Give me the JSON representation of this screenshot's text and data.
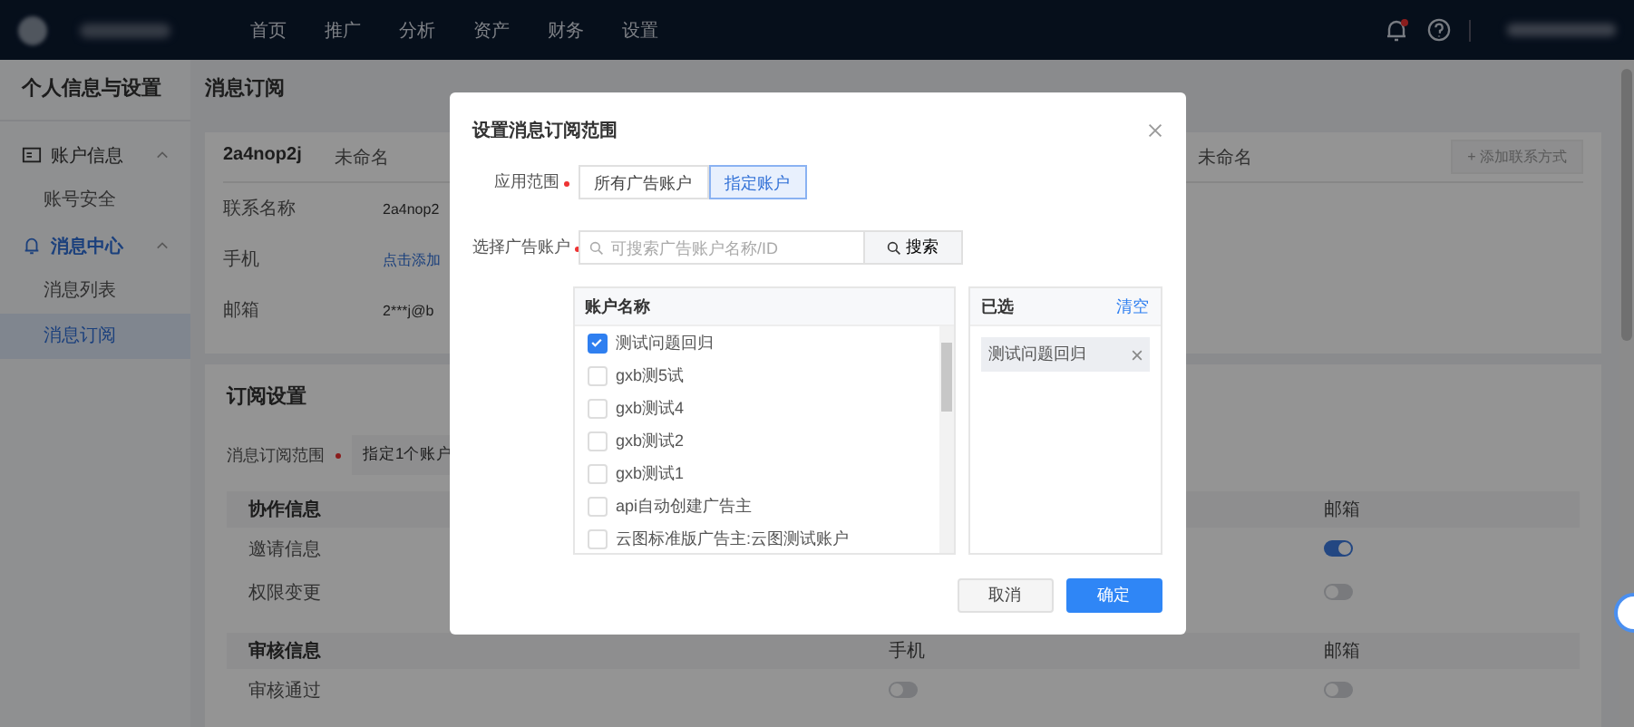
{
  "nav": {
    "items": [
      {
        "label": "首页",
        "selected": false
      },
      {
        "label": "推广",
        "selected": false
      },
      {
        "label": "分析",
        "selected": false
      },
      {
        "label": "资产",
        "selected": false
      },
      {
        "label": "财务",
        "selected": false
      },
      {
        "label": "设置",
        "selected": false
      }
    ],
    "notification_dot": true
  },
  "sidebar": {
    "title": "个人信息与设置",
    "groups": [
      {
        "label": "账户信息",
        "expanded": true,
        "active": false,
        "children": [
          {
            "label": "账号安全",
            "selected": false
          }
        ]
      },
      {
        "label": "消息中心",
        "expanded": true,
        "active": true,
        "children": [
          {
            "label": "消息列表",
            "selected": false
          },
          {
            "label": "消息订阅",
            "selected": true
          }
        ]
      }
    ]
  },
  "page_title": "消息订阅",
  "contact_card": {
    "accounts": [
      {
        "id": "2a4nop2j",
        "name": "未命名"
      },
      {
        "name": "未命名"
      }
    ],
    "add_button": "+ 添加联系方式",
    "fields": [
      {
        "label": "联系名称",
        "value": "2a4nop2",
        "kind": "text"
      },
      {
        "label": "手机",
        "value": "点击添加",
        "kind": "link"
      },
      {
        "label": "邮箱",
        "value": "2***j@b",
        "kind": "text"
      }
    ]
  },
  "settings": {
    "title": "订阅设置",
    "scope_label": "消息订阅范围",
    "scope_value": "指定1个账户",
    "groups": [
      {
        "title": "协作信息",
        "email_label": "邮箱",
        "rows": [
          {
            "label": "邀请信息",
            "email_on": true
          },
          {
            "label": "权限变更",
            "email_on": false
          }
        ]
      },
      {
        "title": "审核信息",
        "phone_label": "手机",
        "email_label": "邮箱",
        "rows": [
          {
            "label": "审核通过",
            "phone_on": false,
            "email_on": false
          }
        ]
      }
    ]
  },
  "dialog": {
    "title": "设置消息订阅范围",
    "scope_label": "应用范围",
    "scope_options": [
      {
        "label": "所有广告账户",
        "selected": false
      },
      {
        "label": "指定账户",
        "selected": true
      }
    ],
    "account_label": "选择广告账户",
    "search_placeholder": "可搜索广告账户名称/ID",
    "search_button": "搜索",
    "list_header": "账户名称",
    "accounts": [
      {
        "name": "测试问题回归",
        "checked": true
      },
      {
        "name": "gxb测5试",
        "checked": false
      },
      {
        "name": "gxb测试4",
        "checked": false
      },
      {
        "name": "gxb测试2",
        "checked": false
      },
      {
        "name": "gxb测试1",
        "checked": false
      },
      {
        "name": "api自动创建广告主",
        "checked": false
      },
      {
        "name": "云图标准版广告主:云图测试账户",
        "checked": false
      }
    ],
    "selected_header": "已选",
    "clear_link": "清空",
    "selected_tags": [
      "测试问题回归"
    ],
    "cancel_button": "取消",
    "confirm_button": "确定"
  }
}
